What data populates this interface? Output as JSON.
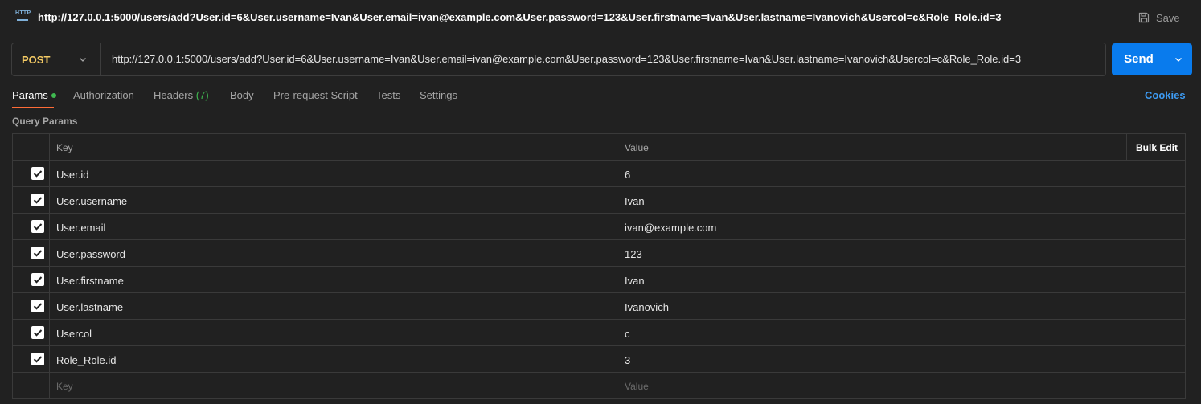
{
  "titlebar": {
    "icon": "http-icon",
    "icon_text": "HTTP",
    "title": "http://127.0.0.1:5000/users/add?User.id=6&User.username=Ivan&User.email=ivan@example.com&User.password=123&User.firstname=Ivan&User.lastname=Ivanovich&Usercol=c&Role_Role.id=3",
    "save_label": "Save"
  },
  "request": {
    "method": "POST",
    "url": "http://127.0.0.1:5000/users/add?User.id=6&User.username=Ivan&User.email=ivan@example.com&User.password=123&User.firstname=Ivan&User.lastname=Ivanovich&Usercol=c&Role_Role.id=3",
    "send_label": "Send"
  },
  "tabs": {
    "params": "Params",
    "authorization": "Authorization",
    "headers": "Headers",
    "headers_count": "(7)",
    "body": "Body",
    "prerequest": "Pre-request Script",
    "tests": "Tests",
    "settings": "Settings",
    "cookies": "Cookies"
  },
  "params": {
    "section_label": "Query Params",
    "header_key": "Key",
    "header_value": "Value",
    "bulk_edit": "Bulk Edit",
    "rows": [
      {
        "key": "User.id",
        "value": "6",
        "checked": true
      },
      {
        "key": "User.username",
        "value": "Ivan",
        "checked": true
      },
      {
        "key": "User.email",
        "value": "ivan@example.com",
        "checked": true
      },
      {
        "key": "User.password",
        "value": "123",
        "checked": true
      },
      {
        "key": "User.firstname",
        "value": "Ivan",
        "checked": true
      },
      {
        "key": "User.lastname",
        "value": "Ivanovich",
        "checked": true
      },
      {
        "key": "Usercol",
        "value": "c",
        "checked": true
      },
      {
        "key": "Role_Role.id",
        "value": "3",
        "checked": true
      }
    ],
    "placeholder_key": "Key",
    "placeholder_value": "Value"
  },
  "colors": {
    "background": "#212121",
    "method": "#f4ca64",
    "send": "#097bed",
    "cookies": "#3d9bf3",
    "active_tab_underline": "#ff6c37",
    "indicator": "#3fb950"
  }
}
